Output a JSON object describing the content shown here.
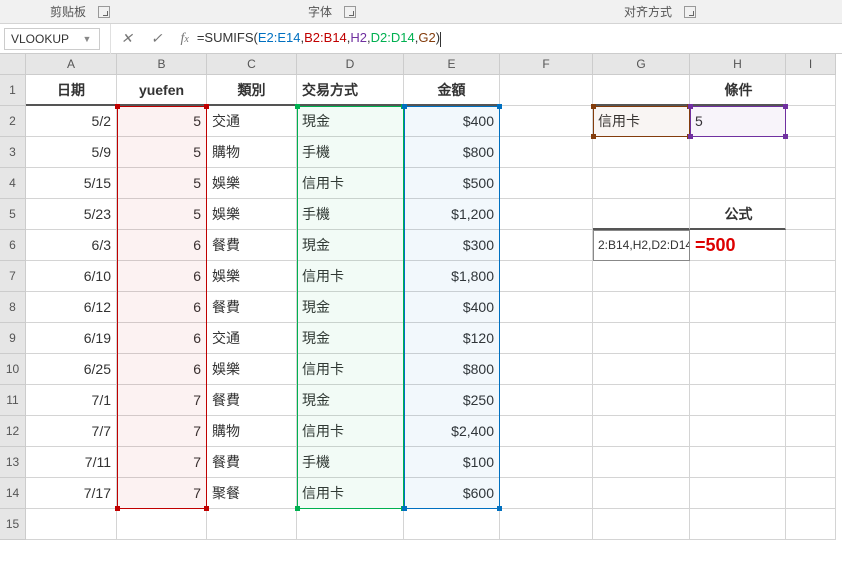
{
  "ribbon": {
    "clipboard": "剪贴板",
    "font": "字体",
    "alignment": "对齐方式"
  },
  "namebox": "VLOOKUP",
  "formula": {
    "prefix": "=SUMIFS(",
    "arg1": "E2:E14",
    "arg2": "B2:B14",
    "arg3": "H2",
    "arg4": "D2:D14",
    "arg5": "G2",
    "suffix": ")"
  },
  "colHeaders": [
    "A",
    "B",
    "C",
    "D",
    "E",
    "F",
    "G",
    "H",
    "I"
  ],
  "rowHeaders": [
    "1",
    "2",
    "3",
    "4",
    "5",
    "6",
    "7",
    "8",
    "9",
    "10",
    "11",
    "12",
    "13",
    "14",
    "15"
  ],
  "header_row": {
    "A": "日期",
    "B": "yuefen",
    "C": "類別",
    "D": "交易方式",
    "E": "金額",
    "G": "條件"
  },
  "conditions": {
    "G2": "信用卡",
    "H2": "5"
  },
  "formula_label": "公式",
  "formula_cell_partial": "2:B14,H2,D2:D14,G2)",
  "result_label": "=500",
  "rows": [
    {
      "A": "5/2",
      "B": "5",
      "C": "交通",
      "D": "現金",
      "E": "$400"
    },
    {
      "A": "5/9",
      "B": "5",
      "C": "購物",
      "D": "手機",
      "E": "$800"
    },
    {
      "A": "5/15",
      "B": "5",
      "C": "娛樂",
      "D": "信用卡",
      "E": "$500"
    },
    {
      "A": "5/23",
      "B": "5",
      "C": "娛樂",
      "D": "手機",
      "E": "$1,200"
    },
    {
      "A": "6/3",
      "B": "6",
      "C": "餐費",
      "D": "現金",
      "E": "$300"
    },
    {
      "A": "6/10",
      "B": "6",
      "C": "娛樂",
      "D": "信用卡",
      "E": "$1,800"
    },
    {
      "A": "6/12",
      "B": "6",
      "C": "餐費",
      "D": "現金",
      "E": "$400"
    },
    {
      "A": "6/19",
      "B": "6",
      "C": "交通",
      "D": "現金",
      "E": "$120"
    },
    {
      "A": "6/25",
      "B": "6",
      "C": "娛樂",
      "D": "信用卡",
      "E": "$800"
    },
    {
      "A": "7/1",
      "B": "7",
      "C": "餐費",
      "D": "現金",
      "E": "$250"
    },
    {
      "A": "7/7",
      "B": "7",
      "C": "購物",
      "D": "信用卡",
      "E": "$2,400"
    },
    {
      "A": "7/11",
      "B": "7",
      "C": "餐費",
      "D": "手機",
      "E": "$100"
    },
    {
      "A": "7/17",
      "B": "7",
      "C": "聚餐",
      "D": "信用卡",
      "E": "$600"
    }
  ],
  "chart_data": {
    "type": "table",
    "title": "SUMIFS example data",
    "columns": [
      "日期",
      "yuefen",
      "類別",
      "交易方式",
      "金額"
    ],
    "data": [
      [
        "5/2",
        5,
        "交通",
        "現金",
        400
      ],
      [
        "5/9",
        5,
        "購物",
        "手機",
        800
      ],
      [
        "5/15",
        5,
        "娛樂",
        "信用卡",
        500
      ],
      [
        "5/23",
        5,
        "娛樂",
        "手機",
        1200
      ],
      [
        "6/3",
        6,
        "餐費",
        "現金",
        300
      ],
      [
        "6/10",
        6,
        "娛樂",
        "信用卡",
        1800
      ],
      [
        "6/12",
        6,
        "餐費",
        "現金",
        400
      ],
      [
        "6/19",
        6,
        "交通",
        "現金",
        120
      ],
      [
        "6/25",
        6,
        "娛樂",
        "信用卡",
        800
      ],
      [
        "7/1",
        7,
        "餐費",
        "現金",
        250
      ],
      [
        "7/7",
        7,
        "購物",
        "信用卡",
        2400
      ],
      [
        "7/11",
        7,
        "餐費",
        "手機",
        100
      ],
      [
        "7/17",
        7,
        "聚餐",
        "信用卡",
        600
      ]
    ],
    "criteria": {
      "交易方式": "信用卡",
      "yuefen": 5
    },
    "result": 500
  }
}
